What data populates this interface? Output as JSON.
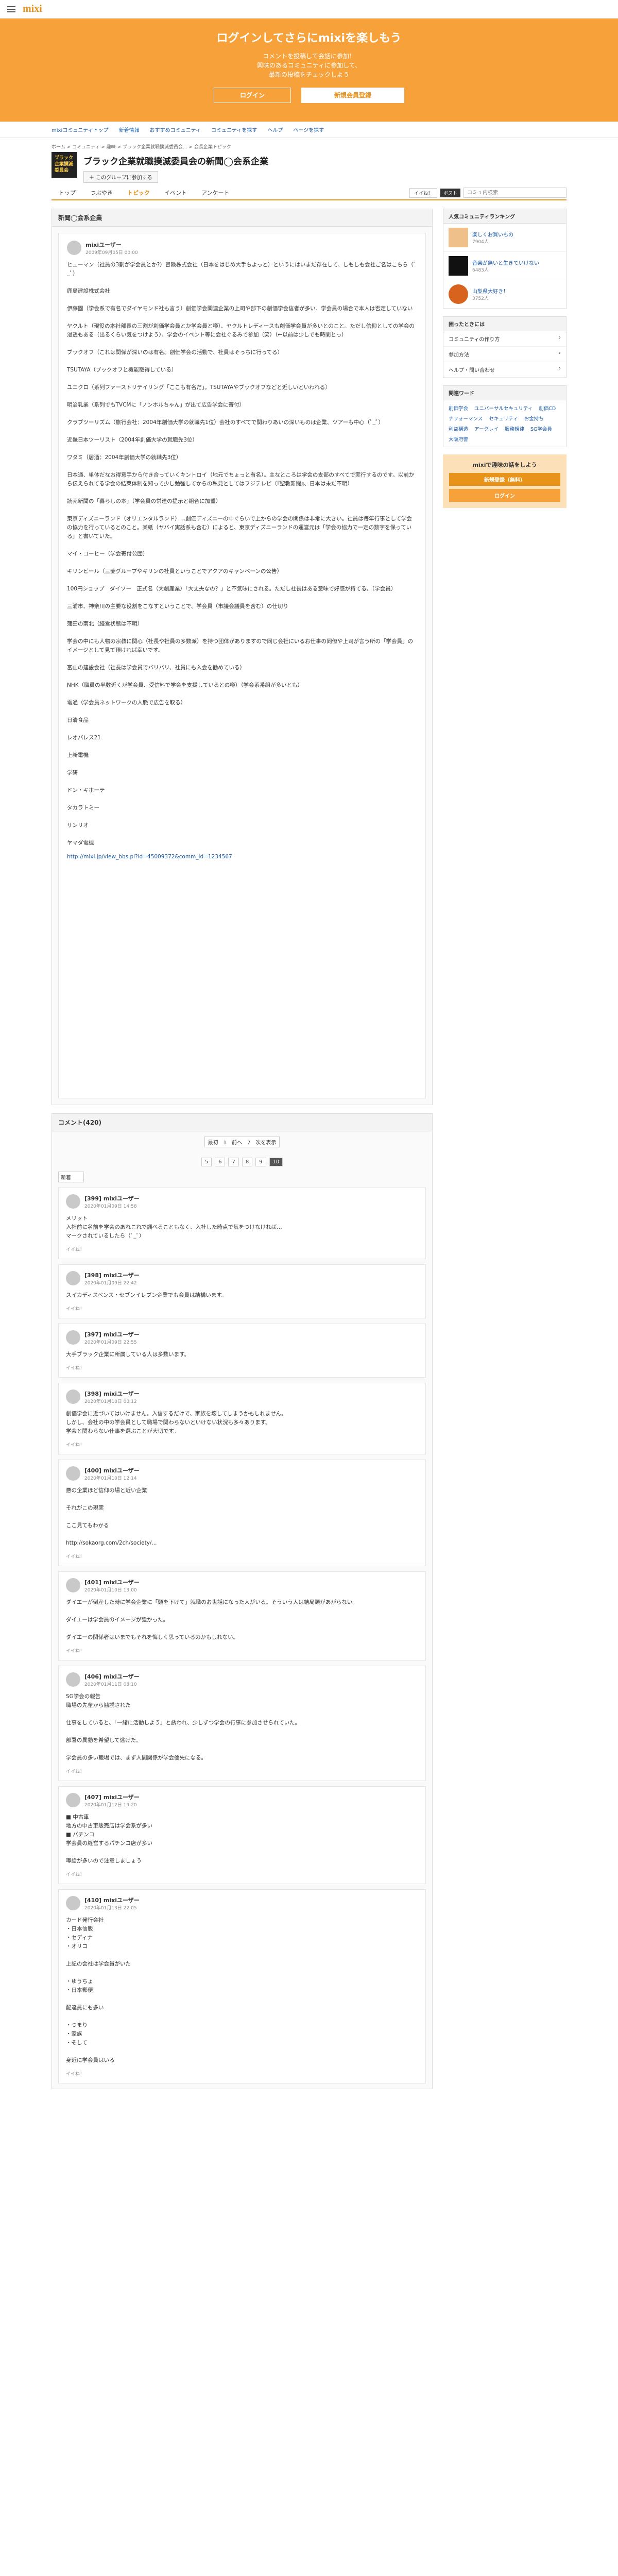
{
  "header": {
    "logo": "mixi"
  },
  "banner": {
    "title": "ログインしてさらにmixiを楽しもう",
    "line1": "コメントを投稿して会話に参加！",
    "line2": "興味のあるコミュニティに参加して、",
    "line3": "最新の投稿をチェックしよう",
    "login_label": "ログイン",
    "register_label": "新規会員登録"
  },
  "gnav": [
    "mixiコミュニティトップ",
    "新着情報",
    "おすすめコミュニティ",
    "コミュニティを探す",
    "ヘルプ",
    "ページを探す"
  ],
  "breadcrumb": "ホーム > コミュニティ > 趣味 > ブラック企業就職撲滅委員会... > 会長企業トピック",
  "community": {
    "thumb_text": "ブラック企業撲滅委員会",
    "title": "ブラック企業就職撲滅委員会の新聞◯会系企業",
    "join_label": "＋ このグループに参加する"
  },
  "tabs": [
    "トップ",
    "つぶやき",
    "トピック",
    "イベント",
    "アンケート"
  ],
  "search": {
    "placeholder": "コミュ内検索",
    "like": "イイね！",
    "share": "ポスト"
  },
  "topic": {
    "heading": "新聞◯会系企業",
    "author": "mixiユーザー",
    "date": "2009年09月05日 00:00",
    "body": "ヒューマン（社員の3割が学会員とか?）冒険株式会社（日本をはじめ大手ちよっと）というにはいまだ存在して、しもしも会社ご名はこちら（ﾟ_ﾟ）\n\n鹿島建設株式会社\n\n伊藤園（学会系で有名でダイヤモンド社も言う）創価学会関連企業の上司や部下の創価学会信者が多い、学会員の場合で本人は否定していない\n\nヤクルト（現役の本社部長の三割が創価学会員とか学会員と噂）、ヤクルトレディースも創価学会員が多いとのこと。ただし信仰としての学会の浸透もある（出るくらい気をつけよう）、学会のイベント等に会社ぐるみで参加（笑）（←以前は少しでも時間とっ）\n\nブックオフ（これは関係が深いのは有名。創価学会の活動で、社員はそっちに行ってる）\n\nTSUTAYA（ブックオフと機能取得している）\n\nユニクロ（系列ファーストリテイリング「ここも有名だ」。TSUTAYAやブックオフなどと近しいといわれる）\n\n明治乳業（系列でもTVCMに「ノンホルちゃん」が出て広告学会に寄付）\n\nクラブツーリズム（旅行会社：2004年創価大学の就職先1位）会社のすべてで関わりあいの深いものは企業、ツアーも中心（ﾟ_ﾟ）\n\n近畿日本ツーリスト（2004年創価大学の就職先3位）\n\nワタミ（居酒：2004年創価大学の就職先3位）\n\n日本通、単体だなお得意手から付き合っていくキントロイ（地元でちょっと有名）。主なところは学会の支部のすべてで実行するのです。以前から伝えられてる学会の結束体制を知って少し勉強してからの私見としてはフジテレビ（『聖教新聞』、日本は未だ不明）\n\n読売新聞の「暮らしの本」（学会員の常連の提示と組合に加盟）\n\n東京ディズニーランド（オリエンタルランド）…創価ディズニーの中ぐらいで上からの学会の関係は非常に大きい。社員は毎年行事として学会の協力を行っているとのこと。某紙（ヤバイ実話系も含む）によると、東京ディズニーランドの運営元は「学会の協力で一定の数字を保っている」と書いていた。\n\nマイ・コーヒー（学会寄付公団）\n\nキリンビール（三菱グループやキリンの社員ということでアクアのキャンペーンの公告）\n\n100円ショップ　ダイソー　正式名（大創産業）「大丈夫なの？」と不気味にされる。ただし社長はある意味で好感が持てる。（学会員）\n\n三浦市、神奈川の主要な役割をこなすということで、学会員（市議会議員を含む）の仕切り\n\n蒲田の南北（経営状態は不明）\n\n学会の中にも人物の宗教に関心（社長や社員の多数派）を持つ団体がありますので同じ会社にいるお仕事の同僚や上司が言う所の「学会員」のイメージとして見て頂ければ幸いです。\n\n富山の建設会社（社長は学会員でバリバリ、社員にも入会を勧めている）\n\nNHK（職員の半数近くが学会員、受信料で学会を支援しているとの噂）（学会系番組が多いとも）\n\n電通（学会員ネットワークの人脈で広告を取る）\n\n日清食品\n\nレオパレス21\n\n上新電機\n\n学研\n\nドン・キホーテ\n\nタカラトミー\n\nサンリオ\n\nヤマダ電機",
    "link": "http://mixi.jp/view_bbs.pl?id=45009372&comm_id=1234567"
  },
  "comments_header": "コメント(420)",
  "pager": {
    "label": "最初　1　前へ　7　次を表示",
    "pages": [
      "5",
      "6",
      "7",
      "8",
      "9",
      "10"
    ],
    "current": "10",
    "sort": "新着"
  },
  "comments": [
    {
      "no": "[399]",
      "user": "mixiユーザー",
      "date": "2020年01月09日 14:58",
      "body": "メリット\n入社前に名前を学会のあれこれで調べることもなく、入社した時点で気をつけなければ…\nマークされているしたら（ﾟ_ﾟ）"
    },
    {
      "no": "[398]",
      "user": "mixiユーザー",
      "date": "2020年01月09日 22:42",
      "body": "スイカディスペンス・セブンイレブン企業でも会員は結構います。"
    },
    {
      "no": "[397]",
      "user": "mixiユーザー",
      "date": "2020年01月09日 22:55",
      "body": "大手ブラック企業に所属している人は多数います。"
    },
    {
      "no": "[398]",
      "user": "mixiユーザー",
      "date": "2020年01月10日 00:12",
      "body": "創価学会に近づいてはいけません。入信するだけで、家族を壊してしまうかもしれません。\nしかし、会社の中の学会員として職場で関わらないといけない状況も多々あります。\n学会と関わらない仕事を選ぶことが大切です。"
    },
    {
      "no": "[400]",
      "user": "mixiユーザー",
      "date": "2020年01月10日 12:14",
      "body": "悪の企業ほど信仰の場と近い企業\n\nそれがこの現実\n\nここ見てもわかる\n\nhttp://sokaorg.com/2ch/society/..."
    },
    {
      "no": "[401]",
      "user": "mixiユーザー",
      "date": "2020年01月10日 13:00",
      "body": "ダイエーが倒産した時に学会企業に「頭を下げて」就職のお世話になった人がいる。そういう人は結局頭があがらない。\n\nダイエーは学会員のイメージが強かった。\n\nダイエーの関係者はいまでもそれを悔しく思っているのかもしれない。"
    },
    {
      "no": "[406]",
      "user": "mixiユーザー",
      "date": "2020年01月11日 08:10",
      "body": "SG学会の報告\n職場の先輩から勧誘された\n\n仕事をしていると、「一緒に活動しよう」と誘われ、少しずつ学会の行事に参加させられていた。\n\n部署の異動を希望して逃げた。\n\n学会員の多い職場では、まず人間関係が学会優先になる。"
    },
    {
      "no": "[407]",
      "user": "mixiユーザー",
      "date": "2020年01月12日 19:20",
      "body": "■ 中古車\n地方の中古車販売店は学会系が多い\n■ パチンコ\n学会員の経営するパチンコ店が多い\n\n噂話が多いので注意しましょう"
    },
    {
      "no": "[410]",
      "user": "mixiユーザー",
      "date": "2020年01月13日 22:05",
      "body": "カード発行会社\n・日本信販\n・セディナ\n・オリコ\n\n上記の会社は学会員がいた\n\n・ゆうちょ\n・日本郵便\n\n配達員にも多い\n\n・つまり\n・家族\n・そして\n\n身近に学会員はいる"
    }
  ],
  "sidebar": {
    "ranking_title": "人気コミュニティランキング",
    "ranking": [
      {
        "name": "楽しくお買いもの",
        "count": "7904人"
      },
      {
        "name": "音楽が無いと生きていけない",
        "count": "6483人"
      },
      {
        "name": "山梨県大好き！",
        "count": "3752人"
      }
    ],
    "help_title": "困ったときには",
    "help": [
      "コミュニティの作り方",
      "参加方法",
      "ヘルプ・問い合わせ"
    ],
    "kw_title": "関連ワード",
    "keywords": [
      "創価学会",
      "ユニバーサルセキュリティ",
      "創価CD",
      "ナフォーマンス",
      "セキュリティ",
      "お金持ち",
      "利益構造",
      "アークレイ",
      "服務規律",
      "SG学会員",
      "大阪府警"
    ],
    "promo_title": "mixiで趣味の話をしよう",
    "promo_register": "新規登録（無料）",
    "promo_login": "ログイン"
  },
  "colors": {
    "accent": "#f6a13a",
    "link": "#1a5aa8"
  }
}
